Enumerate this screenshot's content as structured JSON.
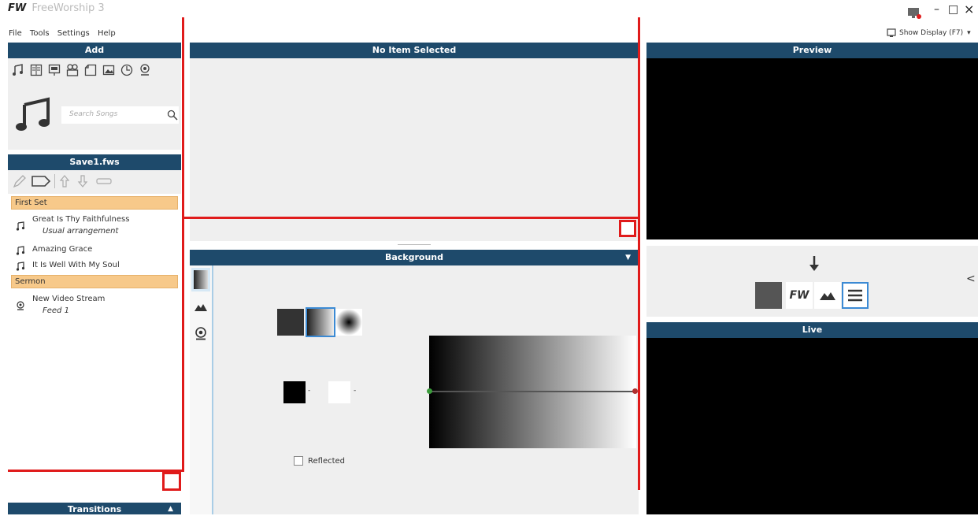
{
  "app": {
    "logo": "FW",
    "title": "FreeWorship 3"
  },
  "menu": [
    "File",
    "Tools",
    "Settings",
    "Help"
  ],
  "window_controls": {
    "minimize": "–",
    "maximize": "□",
    "close": "×"
  },
  "show_display": {
    "label": "Show Display (F7)",
    "arrow": "▾"
  },
  "add_panel": {
    "header": "Add",
    "icons": [
      "music-note-icon",
      "bible-icon",
      "presentation-icon",
      "video-icon",
      "document-icon",
      "image-icon",
      "clock-icon",
      "webcam-icon"
    ],
    "search_placeholder": "Search Songs"
  },
  "service": {
    "header": "Save1.fws",
    "toolbar": [
      "pencil-icon",
      "label-icon",
      "move-up-icon",
      "move-down-icon",
      "remove-icon"
    ],
    "items": [
      {
        "type": "section",
        "label": "First Set"
      },
      {
        "type": "song",
        "title": "Great Is Thy Faithfulness",
        "sub": "Usual arrangement"
      },
      {
        "type": "song",
        "title": "Amazing Grace",
        "sub": ""
      },
      {
        "type": "song",
        "title": "It Is Well With My Soul",
        "sub": ""
      },
      {
        "type": "section",
        "label": "Sermon"
      },
      {
        "type": "video",
        "title": "New Video Stream",
        "sub": "Feed 1"
      }
    ]
  },
  "transitions": {
    "header": "Transitions",
    "arrow": "▲"
  },
  "editor": {
    "header": "No Item Selected"
  },
  "background": {
    "header": "Background",
    "arrow": "▼",
    "reflected_label": "Reflected",
    "stop_a_dash": "-",
    "stop_b_dash": "-"
  },
  "preview": {
    "header": "Preview"
  },
  "live": {
    "header": "Live"
  },
  "controls": {
    "fw_label": "FW",
    "collapse": "<",
    "down_arrow": "🡓"
  }
}
